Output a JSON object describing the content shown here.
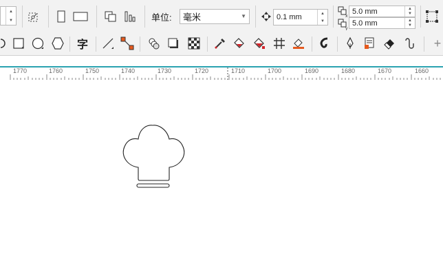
{
  "property_bar": {
    "unit_label": "单位:",
    "unit_value": "毫米",
    "nudge_value": "0.1 mm",
    "dup_x_value": "5.0 mm",
    "dup_y_value": "5.0 mm"
  },
  "toolbox": {
    "tools": [
      "pick-icon",
      "rectangle-icon",
      "ellipse-icon",
      "polygon-icon",
      "text-icon",
      "line-icon",
      "connector-icon",
      "blend-icon",
      "drop-shadow-icon",
      "transparency-icon",
      "eyedropper-icon",
      "fill-icon",
      "interactive-fill-icon",
      "mesh-fill-icon",
      "smart-fill-icon",
      "outline-icon",
      "pen-icon",
      "artistic-media-icon",
      "eraser-icon",
      "smudge-icon",
      "add-icon"
    ],
    "text_tool_glyph": "字"
  },
  "ruler": {
    "ticks": [
      "1770",
      "1760",
      "1750",
      "1740",
      "1730",
      "1720",
      "1710",
      "1700",
      "1690",
      "1680",
      "1670",
      "1660"
    ]
  },
  "accent_color": "#2aa3b0"
}
